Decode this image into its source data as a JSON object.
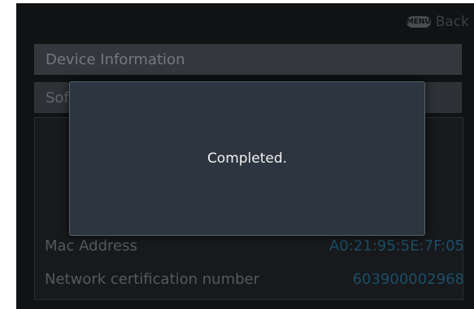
{
  "header": {
    "back_icon": "menu-button-icon",
    "back_icon_text": "MENU",
    "back_label": "Back"
  },
  "menu": {
    "device_information": "Device Information",
    "software_partial": "Sof"
  },
  "info": {
    "mac_label": "Mac Address",
    "mac_value": "A0:21:95:5E:7F:05",
    "cert_label": "Network certification number",
    "cert_value": "603900002968"
  },
  "dialog": {
    "message": "Completed."
  },
  "colors": {
    "screen_bg": "#101214",
    "dialog_bg": "#2c3540",
    "value_accent": "#1b4e66"
  }
}
